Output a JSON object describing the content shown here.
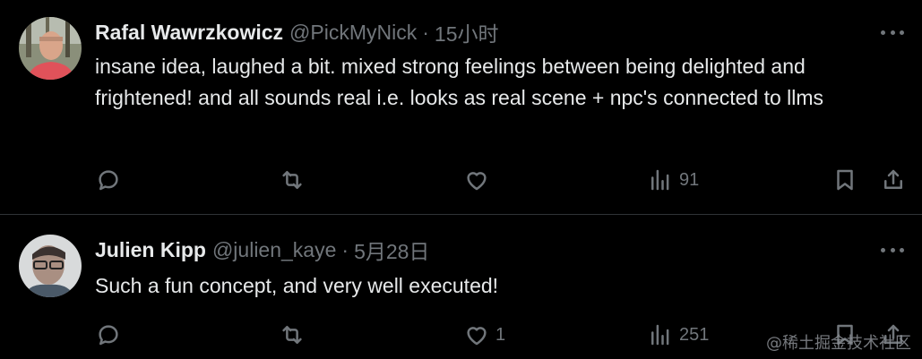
{
  "tweets": [
    {
      "author_name": "Rafal Wawrzkowicz",
      "handle": "@PickMyNick",
      "separator": "·",
      "time": "15小时",
      "text": "insane idea, laughed a bit. mixed strong feelings between being delighted and frightened! and all sounds real i.e. looks as real scene + npc's connected to llms",
      "reply_count": "",
      "retweet_count": "",
      "like_count": "",
      "view_count": "91",
      "avatar_icon": "person-photo-outdoors"
    },
    {
      "author_name": "Julien Kipp",
      "handle": "@julien_kaye",
      "separator": "·",
      "time": "5月28日",
      "text": "Such a fun concept, and very well executed!",
      "reply_count": "",
      "retweet_count": "",
      "like_count": "1",
      "view_count": "251",
      "avatar_icon": "person-photo-glasses"
    }
  ],
  "watermark": "@稀土掘金技术社区",
  "colors": {
    "background": "#000000",
    "text": "#e7e9ea",
    "secondary": "#71767b",
    "divider": "#2f3336"
  }
}
